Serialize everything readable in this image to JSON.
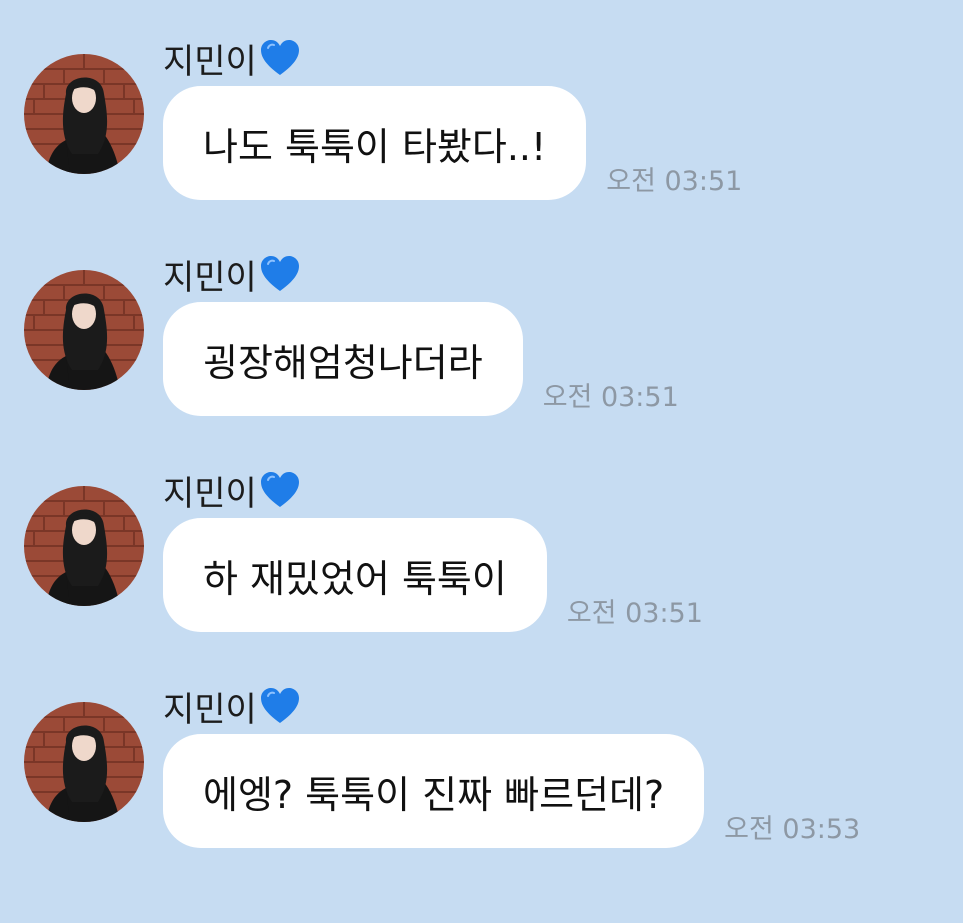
{
  "sender_name": "지민이",
  "sender_emoji": "blue-heart-icon",
  "colors": {
    "background": "#c6dcf2",
    "bubble": "#ffffff",
    "timestamp": "#8d98a4",
    "heart": "#1f7de8"
  },
  "messages": [
    {
      "sender": "지민이",
      "text": "나도 툭툭이 타봤다..!",
      "time": "오전 03:51"
    },
    {
      "sender": "지민이",
      "text": "굉장해엄청나더라",
      "time": "오전 03:51"
    },
    {
      "sender": "지민이",
      "text": "하 재밌었어 툭툭이",
      "time": "오전 03:51"
    },
    {
      "sender": "지민이",
      "text": "에엥? 툭툭이 진짜 빠르던데?",
      "time": "오전 03:53"
    }
  ]
}
